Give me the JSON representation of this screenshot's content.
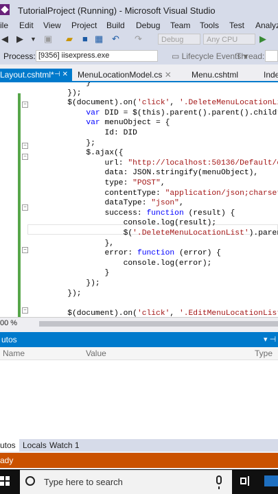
{
  "window": {
    "title": "TutorialProject (Running) - Microsoft Visual Studio"
  },
  "menu": [
    "ile",
    "Edit",
    "View",
    "Project",
    "Build",
    "Debug",
    "Team",
    "Tools",
    "Test",
    "Analyz"
  ],
  "toolbar": {
    "config": "Debug",
    "platform": "Any CPU"
  },
  "process_bar": {
    "label": "Process:",
    "value": "[9356] iisexpress.exe",
    "lifecycle": "Lifecycle Events",
    "thread_label": "Thread:"
  },
  "tabs": [
    {
      "label": "Layout.cshtml*",
      "active": true
    },
    {
      "label": "MenuLocationModel.cs"
    },
    {
      "label": "Menu.cshtml"
    },
    {
      "label": "Inde"
    }
  ],
  "code_lines": [
    "            }",
    "        });",
    "        $(document).on('click', '.DeleteMenuLocationLis",
    "            var DID = $(this).parent().parent().childr",
    "            var menuObject = {",
    "                Id: DID",
    "            };",
    "            $.ajax({",
    "                url: \"http://localhost:50136/Default/c",
    "                data: JSON.stringify(menuObject),",
    "                type: \"POST\",",
    "                contentType: \"application/json;charset",
    "                dataType: \"json\",",
    "                success: function (result) {",
    "                    console.log(result);",
    "                    $('.DeleteMenuLocationList').paren",
    "                },",
    "                error: function (error) {",
    "                    console.log(error);",
    "                }",
    "            });",
    "        });",
    "",
    "        $(document).on('click', '.EditMenuLocationList"
  ],
  "zoom": "00 %",
  "autos": {
    "title": "utos",
    "columns": [
      "Name",
      "Value",
      "Type"
    ]
  },
  "bottom_tabs": [
    "utos",
    "Locals",
    "Watch 1"
  ],
  "status": "ady",
  "taskbar": {
    "search_placeholder": "Type here to search"
  },
  "colors": {
    "accent": "#007acc",
    "status_debug": "#ca5100",
    "chrome": "#d6dbe9"
  }
}
